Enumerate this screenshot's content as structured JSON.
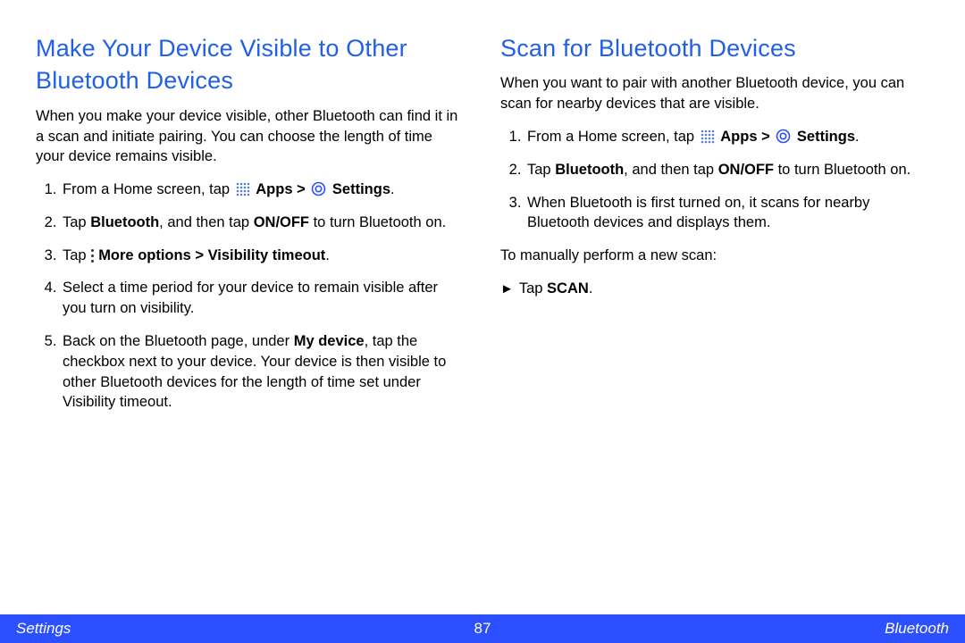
{
  "left": {
    "heading": "Make Your Device Visible to Other Bluetooth Devices",
    "intro": "When you make your device visible, other Bluetooth can find it in a scan and initiate pairing. You can choose the length of time your device remains visible.",
    "step1_a": "From a Home screen, tap ",
    "step1_apps": "Apps",
    "step1_gt": " > ",
    "step1_settings": "Settings",
    "step1_end": ".",
    "step2_a": "Tap ",
    "step2_bt": "Bluetooth",
    "step2_b": ", and then tap ",
    "step2_onoff": "ON/OFF",
    "step2_c": " to turn Bluetooth on.",
    "step3_a": "Tap ",
    "step3_more": "More options > Visibility timeout",
    "step3_end": ".",
    "step4": "Select a time period for your device to remain visible after you turn on visibility.",
    "step5_a": "Back on the Bluetooth page, under ",
    "step5_mydevice": "My device",
    "step5_b": ", tap the checkbox next to your device. Your device is then visible to other Bluetooth devices for the length of time set under Visibility timeout."
  },
  "right": {
    "heading": "Scan for Bluetooth Devices",
    "intro": "When you want to pair with another Bluetooth device, you can scan for nearby devices that are visible.",
    "step1_a": "From a Home screen, tap ",
    "step1_apps": "Apps",
    "step1_gt": " > ",
    "step1_settings": "Settings",
    "step1_end": ".",
    "step2_a": "Tap ",
    "step2_bt": "Bluetooth",
    "step2_b": ", and then tap ",
    "step2_onoff": "ON/OFF",
    "step2_c": " to turn Bluetooth on.",
    "step3": "When Bluetooth is first turned on, it scans for nearby Bluetooth devices and displays them.",
    "manual_label": "To manually perform a new scan:",
    "tap_scan_prefix": "Tap ",
    "tap_scan_word": "SCAN",
    "tap_scan_suffix": "."
  },
  "footer": {
    "left": "Settings",
    "page": "87",
    "right": "Bluetooth"
  }
}
